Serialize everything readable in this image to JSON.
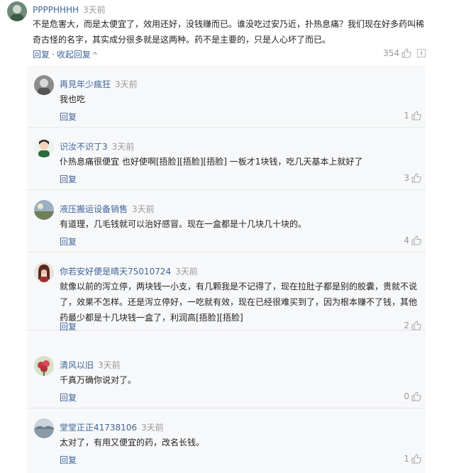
{
  "top_comment": {
    "username": "PPPPHHHH",
    "time": "3天前",
    "text": "不是危害大，而是太便宜了，效用还好，没钱赚而已。谁没吃过安乃近，扑热息痛？我们现在好多药叫稀奇古怪的名字，其实成分很多就是这两种。药不是主要的，只是人心坏了而已。",
    "reply_label": "回复",
    "separator": "·",
    "collapse_label": "收起回复",
    "likes": "354"
  },
  "replies": [
    {
      "username": "再見年少瘋狂",
      "time": "3天前",
      "text": "我也吃",
      "reply_label": "回复",
      "likes": "1"
    },
    {
      "username": "识汝不识丁3",
      "time": "3天前",
      "text": "仆热息痛很便宜 也好使啊[捂脸][捂脸][捂脸] 一板才1块钱，吃几天基本上就好了",
      "reply_label": "回复",
      "likes": "3"
    },
    {
      "username": "液压搬运设备销售",
      "time": "3天前",
      "text": "有道理，几毛钱就可以治好感冒。现在一盒都是十几块几十块的。",
      "reply_label": "回复",
      "likes": "4"
    },
    {
      "username": "你若安好便是晴天75010724",
      "time": "3天前",
      "text": "就像以前的泻立停，两块钱一小支，有几颗我是不记得了，现在拉肚子都是别的胶囊，贵就不说了，效果不怎样。还是泻立停好，一吃就有效，现在已经很难买到了，因为根本赚不了钱，其他药最少都是十几块钱一盒了，利润高[捂脸][捂脸]",
      "reply_label": "回复",
      "likes": "2"
    },
    {
      "username": "清风以旧",
      "time": "3天前",
      "text": "千真万确你说对了。",
      "reply_label": "回复",
      "likes": "0"
    },
    {
      "username": "堂堂正正41738106",
      "time": "3天前",
      "text": "太对了，有用又便宜的药，改名长钱。",
      "reply_label": "回复",
      "likes": "1"
    }
  ],
  "colors": {
    "link": "#406599",
    "muted": "#999999",
    "reply_bg": "#f7f8fa"
  }
}
